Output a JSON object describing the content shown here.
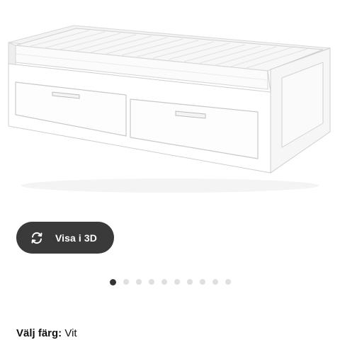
{
  "product": {
    "image_name": "white daybed with two drawers and mattress"
  },
  "view_3d_button": {
    "label": "Visa i 3D",
    "icon": "rotate-3d-icon"
  },
  "carousel": {
    "total": 10,
    "active_index": 0
  },
  "color_selector": {
    "label": "Välj färg:",
    "value": "Vit"
  }
}
